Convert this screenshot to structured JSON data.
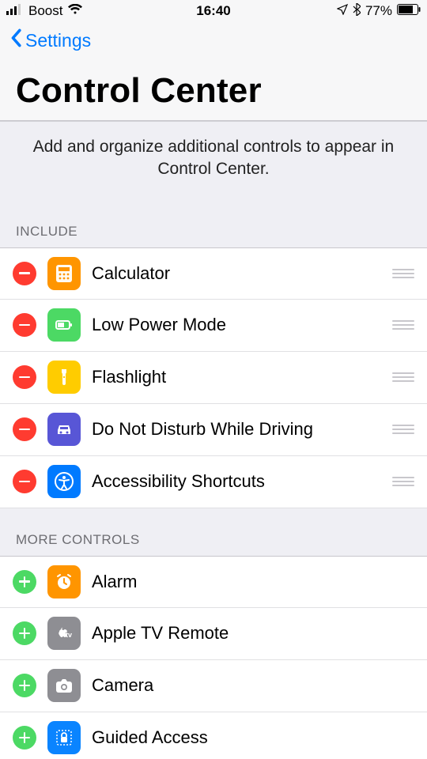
{
  "status": {
    "carrier": "Boost",
    "time": "16:40",
    "battery_pct": "77%"
  },
  "nav": {
    "back_label": "Settings"
  },
  "page": {
    "title": "Control Center",
    "description": "Add and organize additional controls to appear in Control Center."
  },
  "sections": {
    "include_header": "Include",
    "more_header": "More Controls"
  },
  "include": [
    {
      "label": "Calculator",
      "icon": "calculator",
      "bg": "ic-orange"
    },
    {
      "label": "Low Power Mode",
      "icon": "battery",
      "bg": "ic-green"
    },
    {
      "label": "Flashlight",
      "icon": "flashlight",
      "bg": "ic-yellow"
    },
    {
      "label": "Do Not Disturb While Driving",
      "icon": "car",
      "bg": "ic-indigo"
    },
    {
      "label": "Accessibility Shortcuts",
      "icon": "accessibility",
      "bg": "ic-blue"
    }
  ],
  "more": [
    {
      "label": "Alarm",
      "icon": "alarm",
      "bg": "ic-orange"
    },
    {
      "label": "Apple TV Remote",
      "icon": "appletv",
      "bg": "ic-gray"
    },
    {
      "label": "Camera",
      "icon": "camera",
      "bg": "ic-gray"
    },
    {
      "label": "Guided Access",
      "icon": "lock",
      "bg": "ic-blue2"
    }
  ]
}
